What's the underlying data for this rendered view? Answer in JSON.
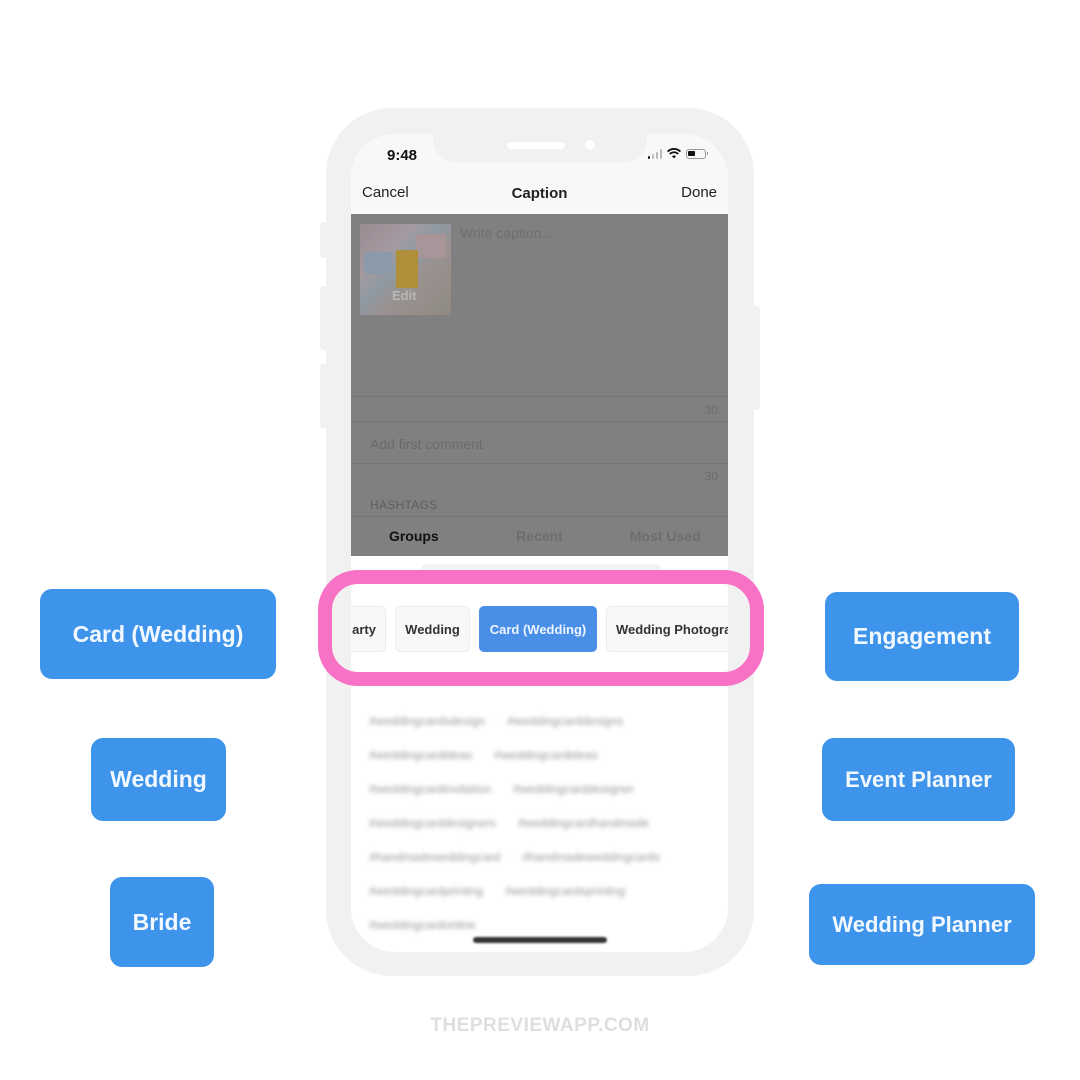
{
  "status_bar": {
    "time": "9:48",
    "icons": [
      "cellular-signal-icon",
      "wifi-icon",
      "battery-icon"
    ]
  },
  "nav": {
    "cancel_label": "Cancel",
    "title": "Caption",
    "done_label": "Done"
  },
  "caption": {
    "thumbnail_edit_label": "Edit",
    "placeholder": "Write caption...",
    "caption_remaining": "30"
  },
  "comment": {
    "placeholder": "Add first comment",
    "comment_remaining": "30"
  },
  "hashtags": {
    "section_label": "HASHTAGS",
    "tabs": [
      {
        "label": "Groups",
        "active": true
      },
      {
        "label": "Recent",
        "active": false
      },
      {
        "label": "Most Used",
        "active": false
      }
    ],
    "groups": [
      {
        "label": "arty",
        "selected": false
      },
      {
        "label": "Wedding",
        "selected": false
      },
      {
        "label": "Card (Wedding)",
        "selected": true
      },
      {
        "label": "Wedding Photogra",
        "selected": false
      }
    ],
    "tag_rows": [
      [
        "#weddingcardsdesign",
        "#weddingcarddesigns"
      ],
      [
        "#weddingcardideas",
        "#weddingcardideas"
      ],
      [
        "#weddingcardinvitation",
        "#weddingcarddesigner"
      ],
      [
        "#weddingcarddesigners",
        "#weddingcardhandmade"
      ],
      [
        "#handmadeweddingcard",
        "#handmadeweddingcards"
      ],
      [
        "#weddingcardprinting",
        "#weddingcardsprinting"
      ],
      [
        "#weddingcardonline"
      ]
    ]
  },
  "side_labels": {
    "left": [
      "Card (Wedding)",
      "Wedding",
      "Bride"
    ],
    "right": [
      "Engagement",
      "Event Planner",
      "Wedding Planner"
    ]
  },
  "colors": {
    "label_blue": "#3d94ea",
    "selected_chip_blue": "#4a8fe7",
    "highlight_pink": "#f772c4"
  },
  "footer": {
    "watermark": "THEPREVIEWAPP.COM"
  }
}
